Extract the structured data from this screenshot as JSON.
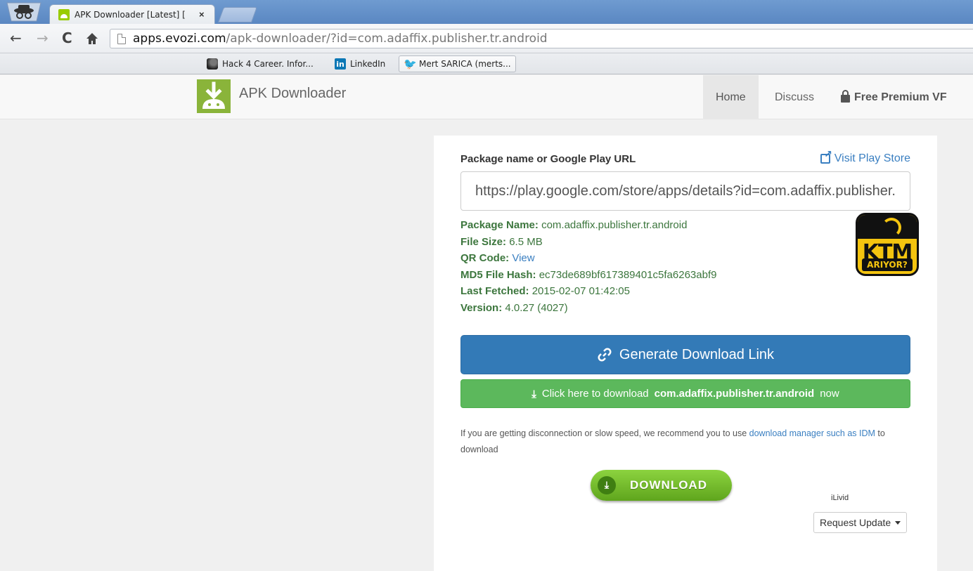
{
  "browser": {
    "tab_title": "APK Downloader [Latest] [",
    "url_host": "apps.evozi.com",
    "url_path": "/apk-downloader/?id=com.adaffix.publisher.tr.android",
    "bookmarks": [
      {
        "label": "Hack 4 Career. Infor...",
        "icon": "hack4career-icon"
      },
      {
        "label": "LinkedIn",
        "icon": "linkedin-icon"
      },
      {
        "label": "Mert SARICA (merts...",
        "icon": "twitter-icon"
      }
    ]
  },
  "site": {
    "brand": "APK Downloader",
    "nav": {
      "home": "Home",
      "discuss": "Discuss",
      "premium": "Free Premium VF"
    }
  },
  "form": {
    "label": "Package name or Google Play URL",
    "visit_link": "Visit Play Store",
    "url_value": "https://play.google.com/store/apps/details?id=com.adaffix.publisher.tr.android"
  },
  "info": {
    "package_name_label": "Package Name:",
    "package_name": "com.adaffix.publisher.tr.android",
    "file_size_label": "File Size:",
    "file_size": "6.5 MB",
    "qr_label": "QR Code:",
    "qr_link": "View",
    "md5_label": "MD5 File Hash:",
    "md5": "ec73de689bf617389401c5fa6263abf9",
    "fetched_label": "Last Fetched:",
    "fetched": "2015-02-07 01:42:05",
    "version_label": "Version:",
    "version": "4.0.27 (4027)"
  },
  "app_icon": {
    "main": "KTM",
    "sub": "ARIYOR?"
  },
  "buttons": {
    "generate": "Generate Download Link",
    "download_prefix": "Click here to download",
    "download_pkg": "com.adaffix.publisher.tr.android",
    "download_suffix": "now",
    "big_download": "DOWNLOAD",
    "ilivid": "iLivid",
    "request_update": "Request Update"
  },
  "note": {
    "text": "If you are getting disconnection or slow speed, we recommend you to use",
    "link": "download manager such as IDM",
    "suffix": "to download"
  }
}
